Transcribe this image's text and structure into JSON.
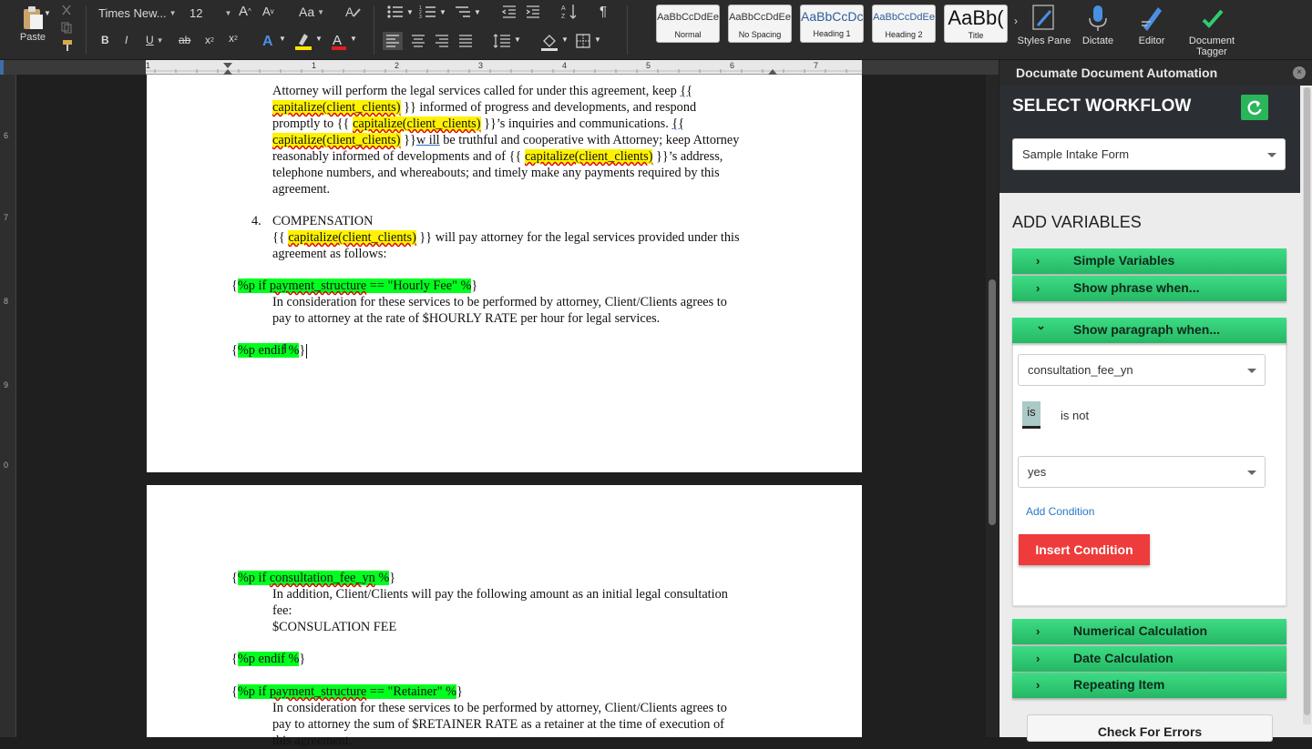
{
  "ribbon": {
    "paste": "Paste",
    "font_name": "Times New...",
    "font_size": "12",
    "grow_font": "A",
    "shrink_font": "A",
    "change_case": "Aa",
    "bold": "B",
    "italic": "I",
    "underline": "U",
    "strikethrough": "ab",
    "subscript": "x",
    "superscript": "x",
    "styles": [
      {
        "preview": "AaBbCcDdEe",
        "name": "Normal"
      },
      {
        "preview": "AaBbCcDdEe",
        "name": "No Spacing"
      },
      {
        "preview": "AaBbCcDc",
        "name": "Heading 1"
      },
      {
        "preview": "AaBbCcDdEe",
        "name": "Heading 2"
      },
      {
        "preview": "AaBb(",
        "name": "Title"
      }
    ],
    "styles_pane": "Styles Pane",
    "dictate": "Dictate",
    "editor": "Editor",
    "document_tagger": "Document Tagger",
    "accent_colors": {
      "highlight": "#ffe600",
      "font_color": "#e02020"
    }
  },
  "ruler": {
    "numbers": [
      "1",
      "1",
      "2",
      "3",
      "4",
      "5",
      "6",
      "7"
    ]
  },
  "vruler": {
    "numbers": [
      "6",
      "7",
      "8",
      "9",
      "0"
    ]
  },
  "document": {
    "page1": {
      "p1_l1": "Attorney will perform the legal services called for under this agreement, keep",
      "p1_l1_tag": "{{",
      "p1_l2_a": "capitalize(client_clients)",
      "p1_l2_b": " }} informed of progress and developments, and respond",
      "p1_l3_a": "promptly to {{ ",
      "p1_l3_b": "capitalize(client_clients)",
      "p1_l3_c": " }}’s inquiries and communications. ",
      "p1_l3_d": "{{",
      "p1_l4_a": "capitalize(client_clients)",
      "p1_l4_b": " }}",
      "p1_l4_c": "w ill",
      "p1_l4_d": " be truthful and cooperative with Attorney; keep Attorney",
      "p1_l5_a": "reasonably informed of developments and of {{ ",
      "p1_l5_b": "capitalize(client_clients)",
      "p1_l5_c": " }}’s address,",
      "p1_l6": "telephone numbers, and whereabouts; and timely make any payments required by this",
      "p1_l7": "agreement.",
      "sec4_num": "4.",
      "sec4_title": "COMPENSATION",
      "p2_l1_a": "{{ ",
      "p2_l1_b": "capitalize(client_clients)",
      "p2_l1_c": " }} will pay attorney for the legal services provided under this",
      "p2_l2": "agreement as follows:",
      "if1_a": "{",
      "if1_b": "%p if ",
      "if1_c": "payment_structure",
      "if1_d": " == \"Hourly Fee\" %",
      "if1_e": "}",
      "hourly_l1": "In consideration for these services to be performed by attorney, Client/Clients agrees to",
      "hourly_l2": "pay to attorney at the rate of $HOURLY RATE per hour for legal services.",
      "endif1_a": "{",
      "endif1_b": "%p endif %",
      "endif1_c": "}"
    },
    "page2": {
      "if2_a": "{",
      "if2_b": "%p if ",
      "if2_c": "consultation_fee_yn",
      "if2_d": " %",
      "if2_e": "}",
      "consult_l1": "In addition, Client/Clients will pay the following amount as an initial legal consultation",
      "consult_l2": "fee:",
      "consult_l3": "$CONSULATION FEE",
      "endif2_a": "{",
      "endif2_b": "%p endif %",
      "endif2_c": "}",
      "if3_a": "{",
      "if3_b": "%p if ",
      "if3_c": "payment_structure",
      "if3_d": " == \"Retainer\" %",
      "if3_e": "}",
      "ret_l1": "In consideration for these services to be performed by attorney, Client/Clients agrees to",
      "ret_l2": "pay to attorney the sum of $RETAINER RATE as a retainer at the time of execution of",
      "ret_l3": "this agreement."
    }
  },
  "pane": {
    "title": "Documate Document Automation",
    "close": "×",
    "select_workflow": "SELECT WORKFLOW",
    "workflow_value": "Sample Intake Form",
    "add_variables": "ADD VARIABLES",
    "accordions": {
      "simple": "Simple Variables",
      "phrase": "Show phrase when...",
      "paragraph": "Show paragraph when...",
      "numerical": "Numerical Calculation",
      "date": "Date Calculation",
      "repeating": "Repeating Item"
    },
    "chevron_right": "›",
    "chevron_down": "⌄",
    "condition_field": "consultation_fee_yn",
    "is_label": "is",
    "is_not_label": "is not",
    "condition_value": "yes",
    "add_condition": "Add Condition",
    "insert_condition": "Insert Condition",
    "check_errors": "Check For Errors",
    "accent_colors": {
      "green": "#2ecc71",
      "red": "#ee3b3b",
      "link": "#2a78c8"
    }
  }
}
